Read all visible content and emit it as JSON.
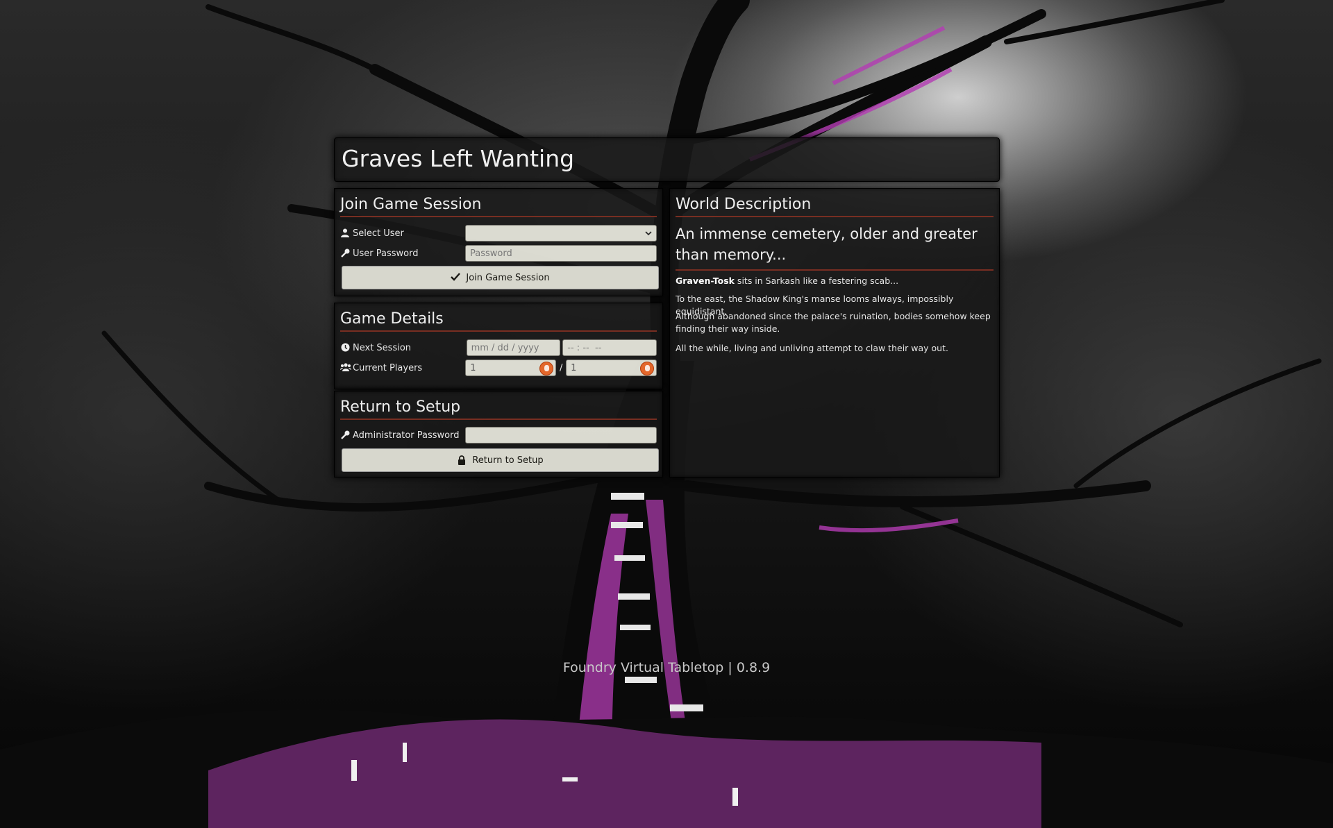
{
  "world": {
    "title": "Graves Left Wanting"
  },
  "join": {
    "heading": "Join Game Session",
    "select_user_label": "Select User",
    "select_user_value": "",
    "password_label": "User Password",
    "password_placeholder": "Password",
    "button_label": "Join Game Session"
  },
  "details": {
    "heading": "Game Details",
    "next_session_label": "Next Session",
    "date_placeholder": "mm / dd / yyyy",
    "time_placeholder": "-- : --  --",
    "current_players_label": "Current Players",
    "current_players": "1",
    "max_players": "1",
    "separator": "/"
  },
  "setup": {
    "heading": "Return to Setup",
    "admin_password_label": "Administrator Password",
    "admin_password_value": "",
    "button_label": "Return to Setup"
  },
  "description": {
    "heading": "World Description",
    "subtitle": "An immense cemetery, older and greater than memory...",
    "p1_bold": "Graven-Tosk",
    "p1_rest": " sits in Sarkash like a festering scab...",
    "p2": "To the east, the Shadow King's manse looms always, impossibly equidistant.",
    "p3": "Although abandoned since the palace's ruination, bodies somehow keep finding their way inside.",
    "p4": "All the while, living and unliving attempt to claw their way out."
  },
  "footer": {
    "text": "Foundry Virtual Tabletop | 0.8.9"
  },
  "colors": {
    "accent_rule": "#782e22",
    "tree_accent": "#b43cb4",
    "button_bg": "#e1e1d7"
  },
  "icons": {
    "select_user": "user-icon",
    "password": "key-icon",
    "join": "check-icon",
    "next_session": "clock-icon",
    "players": "users-icon",
    "admin_password": "key-icon",
    "setup": "lock-icon",
    "player_badge": "duckduckgo-icon"
  }
}
